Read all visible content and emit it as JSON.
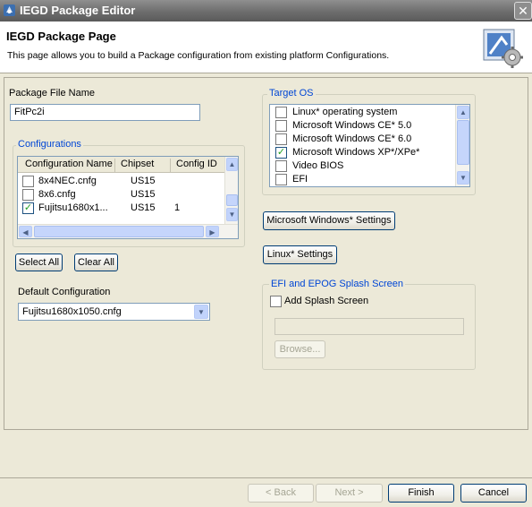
{
  "window": {
    "title": "IEGD Package Editor",
    "close_glyph": "✕"
  },
  "header": {
    "title": "IEGD Package Page",
    "description": "This page allows you to build a Package configuration from existing platform Configurations."
  },
  "package_file": {
    "label": "Package File Name",
    "value": "FitPc2i"
  },
  "configurations": {
    "group_label": "Configurations",
    "columns": [
      "Configuration Name",
      "Chipset",
      "Config ID"
    ],
    "rows": [
      {
        "name": "8x4NEC.cnfg",
        "chipset": "US15",
        "config_id": "",
        "checked": false
      },
      {
        "name": "8x6.cnfg",
        "chipset": "US15",
        "config_id": "",
        "checked": false
      },
      {
        "name": "Fujitsu1680x1...",
        "chipset": "US15",
        "config_id": "1",
        "checked": true
      }
    ],
    "select_all": "Select All",
    "clear_all": "Clear All"
  },
  "default_configuration": {
    "label": "Default Configuration",
    "value": "Fujitsu1680x1050.cnfg"
  },
  "target_os": {
    "group_label": "Target OS",
    "items": [
      {
        "label": "Linux* operating system",
        "checked": false
      },
      {
        "label": "Microsoft Windows CE* 5.0",
        "checked": false
      },
      {
        "label": "Microsoft Windows CE* 6.0",
        "checked": false
      },
      {
        "label": "Microsoft Windows XP*/XPe*",
        "checked": true
      },
      {
        "label": "Video BIOS",
        "checked": false
      },
      {
        "label": "EFI",
        "checked": false
      }
    ]
  },
  "buttons": {
    "windows_settings": "Microsoft Windows* Settings",
    "linux_settings": "Linux* Settings",
    "back": "< Back",
    "next": "Next >",
    "finish": "Finish",
    "cancel": "Cancel"
  },
  "splash": {
    "group_label": "EFI and EPOG Splash Screen",
    "checkbox_label": "Add Splash Screen",
    "checked": false,
    "path_value": "",
    "browse": "Browse..."
  },
  "colors": {
    "accent": "#0046d5",
    "background": "#ece9d8",
    "check": "#21a121"
  },
  "icons": [
    "app-icon",
    "wizard-banner-icon",
    "close-icon",
    "check-icon",
    "scroll-up-icon",
    "scroll-down-icon",
    "scroll-left-icon",
    "scroll-right-icon",
    "dropdown-arrow-icon"
  ]
}
